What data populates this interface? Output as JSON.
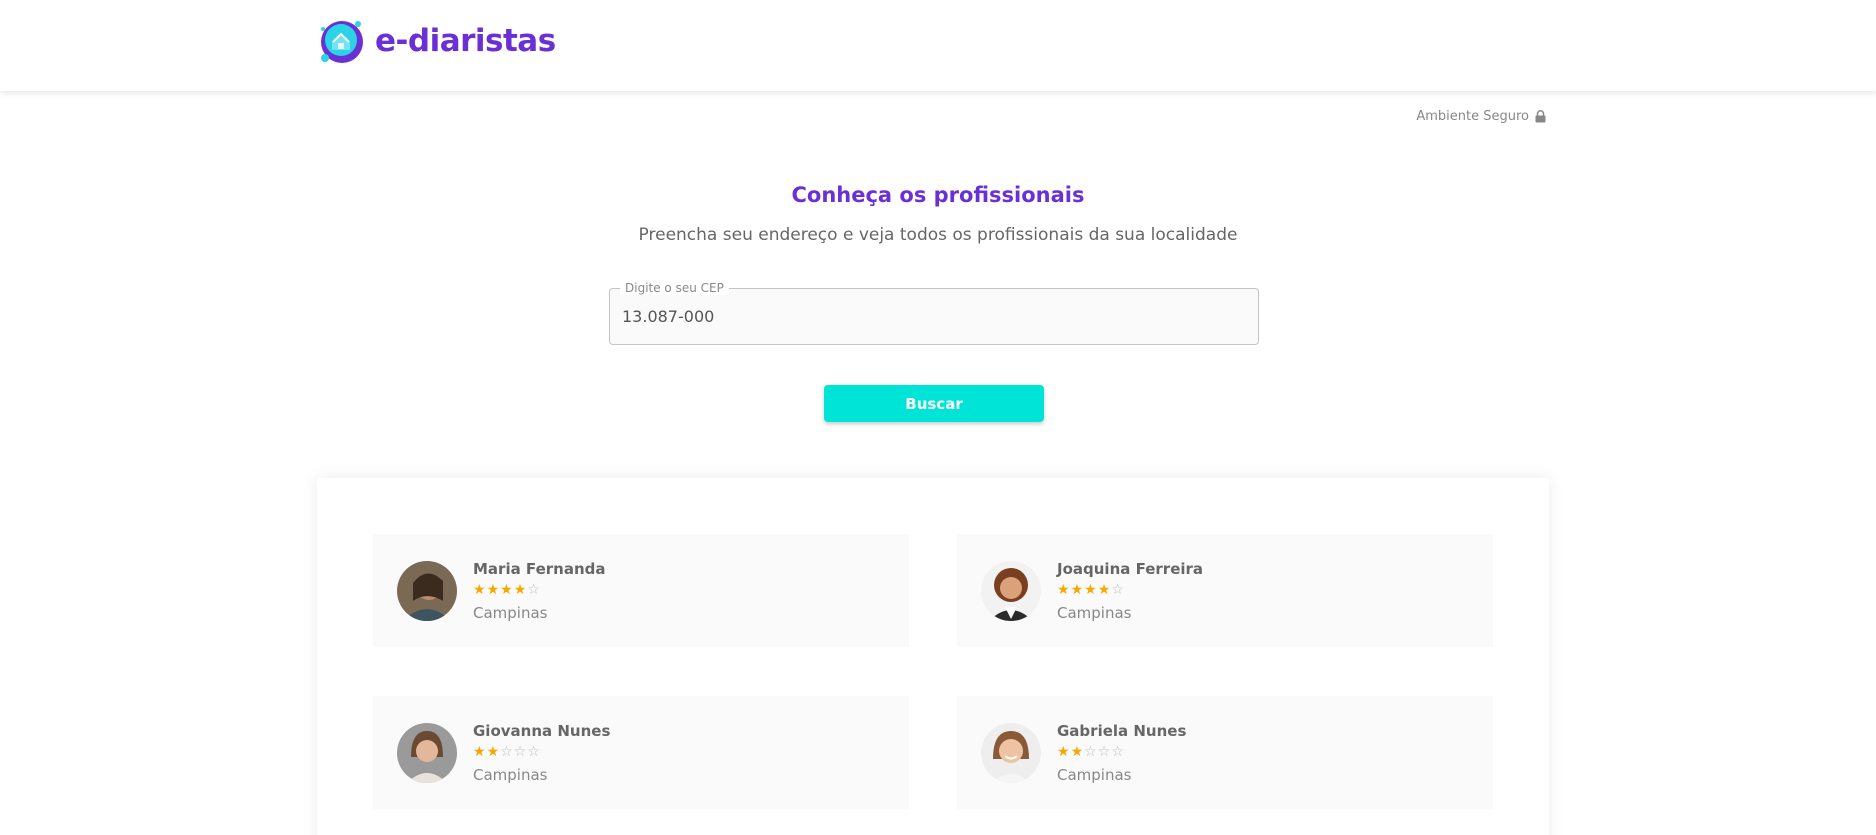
{
  "header": {
    "brand": "e-diaristas"
  },
  "secure_badge": {
    "label": "Ambiente Seguro",
    "icon": "lock-icon"
  },
  "search": {
    "title": "Conheça os profissionais",
    "subtitle": "Preencha seu endereço e veja todos os profissionais da sua localidade",
    "cep_label": "Digite o seu CEP",
    "cep_value": "13.087-000",
    "button_label": "Buscar"
  },
  "colors": {
    "brand_purple": "#6b2fd6",
    "button_cyan": "#00e4d7",
    "star": "#f5a800"
  },
  "professionals": [
    {
      "name": "Maria Fernanda",
      "rating": 4,
      "max_rating": 5,
      "city": "Campinas"
    },
    {
      "name": "Joaquina Ferreira",
      "rating": 4,
      "max_rating": 5,
      "city": "Campinas"
    },
    {
      "name": "Giovanna Nunes",
      "rating": 2,
      "max_rating": 5,
      "city": "Campinas"
    },
    {
      "name": "Gabriela Nunes",
      "rating": 2,
      "max_rating": 5,
      "city": "Campinas"
    }
  ]
}
